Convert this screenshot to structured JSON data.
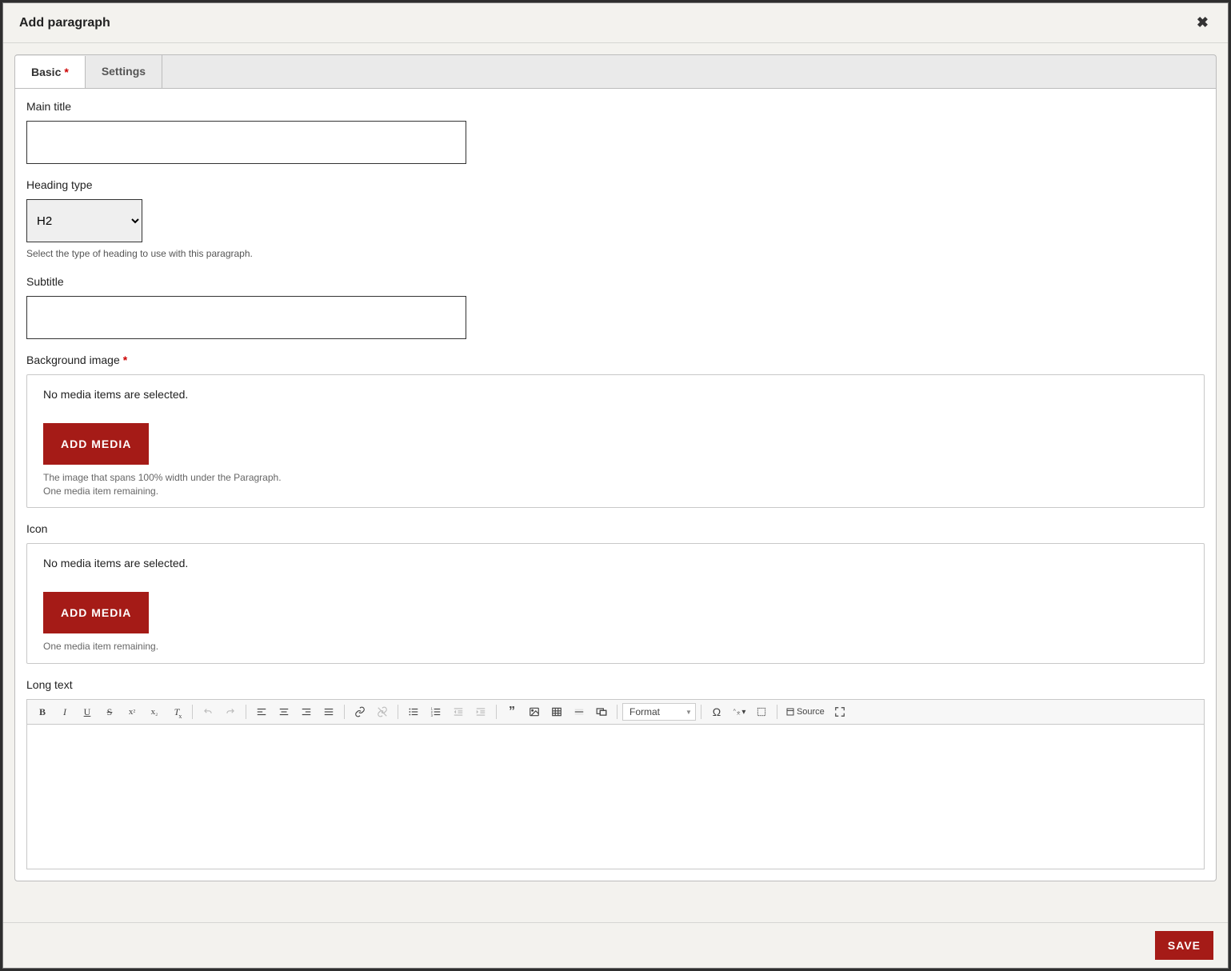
{
  "modal": {
    "title": "Add paragraph"
  },
  "tabs": {
    "basic_label": "Basic",
    "basic_required": true,
    "settings_label": "Settings"
  },
  "fields": {
    "main_title": {
      "label": "Main title",
      "value": ""
    },
    "heading_type": {
      "label": "Heading type",
      "value": "H2",
      "help": "Select the type of heading to use with this paragraph."
    },
    "subtitle": {
      "label": "Subtitle",
      "value": ""
    },
    "background_image": {
      "label": "Background image",
      "required": true,
      "empty_text": "No media items are selected.",
      "button": "ADD MEDIA",
      "help1": "The image that spans 100% width under the Paragraph.",
      "help2": "One media item remaining."
    },
    "icon": {
      "label": "Icon",
      "empty_text": "No media items are selected.",
      "button": "ADD MEDIA",
      "help1": "One media item remaining."
    },
    "long_text": {
      "label": "Long text"
    }
  },
  "editor": {
    "format_label": "Format",
    "source_label": "Source"
  },
  "footer": {
    "save_label": "SAVE"
  }
}
